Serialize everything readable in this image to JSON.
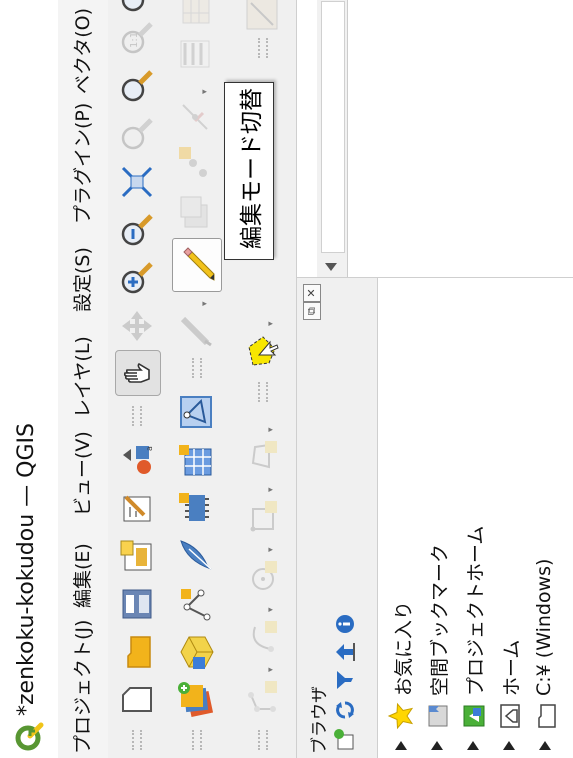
{
  "window": {
    "title": "*zenkoku-kokudou — QGIS"
  },
  "menu": [
    {
      "label": "プロジェクト(J)"
    },
    {
      "label": "編集(E)"
    },
    {
      "label": "ビュー(V)"
    },
    {
      "label": "レイヤ(L)"
    },
    {
      "label": "設定(S)"
    },
    {
      "label": "プラグイン(P)"
    },
    {
      "label": "ベクタ(O)"
    }
  ],
  "tooltip": {
    "text": "編集モード切替"
  },
  "browser_panel": {
    "title": "ブラウザ",
    "items": [
      {
        "label": "お気に入り",
        "icon": "star-icon"
      },
      {
        "label": "空間ブックマーク",
        "icon": "bookmark-icon"
      },
      {
        "label": "プロジェクトホーム",
        "icon": "project-home-icon"
      },
      {
        "label": "ホーム",
        "icon": "home-folder-icon"
      },
      {
        "label": "C:¥ (Windows)",
        "icon": "drive-icon"
      }
    ]
  },
  "colors": {
    "qgis_green": "#589632",
    "qgis_yellow": "#ffd600",
    "tooltip_border": "#333333"
  }
}
